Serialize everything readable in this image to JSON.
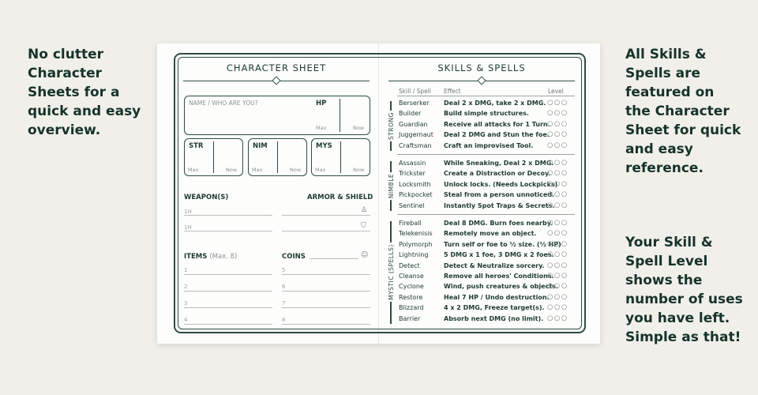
{
  "left_caption": "No clutter Character Sheets for a quick and easy overview.",
  "right_caption_top": "All Skills & Spells are featured on the Character Sheet for quick and easy reference.",
  "right_caption_bottom": "Your Skill & Spell Level shows the number of uses you have left. Simple as that!",
  "character_sheet": {
    "title": "CHARACTER SHEET",
    "name_placeholder": "NAME / WHO ARE YOU?",
    "hp_label": "HP",
    "max": "Max",
    "now": "Now",
    "stats": [
      "STR",
      "NIM",
      "MYS"
    ],
    "weapons_label": "WEAPON(S)",
    "armor_label": "ARMOR & SHIELD",
    "hand": "1H",
    "items_label": "ITEMS",
    "items_note": "(Max. 8)",
    "coins_label": "COINS",
    "item_numbers": [
      "1",
      "2",
      "3",
      "4",
      "5",
      "6",
      "7",
      "8"
    ]
  },
  "skills_spells": {
    "title": "SKILLS & SPELLS",
    "col_skill": "Skill / Spell",
    "col_effect": "Effect",
    "col_level": "Level",
    "groups": [
      {
        "label": "STRONG",
        "rows": [
          {
            "name": "Berserker",
            "effect": "Deal 2 x DMG, take 2 x DMG."
          },
          {
            "name": "Builder",
            "effect": "Build simple structures."
          },
          {
            "name": "Guardian",
            "effect": "Receive all attacks for 1 Turn."
          },
          {
            "name": "Juggernaut",
            "effect": "Deal 2 DMG and Stun the foe."
          },
          {
            "name": "Craftsman",
            "effect": "Craft an improvised Tool."
          }
        ]
      },
      {
        "label": "NIMBLE",
        "rows": [
          {
            "name": "Assassin",
            "effect": "While Sneaking, Deal 2 x DMG."
          },
          {
            "name": "Trickster",
            "effect": "Create a Distraction or Decoy."
          },
          {
            "name": "Locksmith",
            "effect": "Unlock locks. (Needs Lockpicks)"
          },
          {
            "name": "Pickpocket",
            "effect": "Steal from a person unnoticed."
          },
          {
            "name": "Sentinel",
            "effect": "Instantly Spot Traps & Secrets."
          }
        ]
      },
      {
        "label": "MYSTIC (SPELLS)",
        "rows": [
          {
            "name": "Fireball",
            "effect": "Deal 8 DMG. Burn foes nearby."
          },
          {
            "name": "Telekenisis",
            "effect": "Remotely move an object."
          },
          {
            "name": "Polymorph",
            "effect": "Turn self or foe to ½ size. (½ HP)"
          },
          {
            "name": "Lightning",
            "effect": "5 DMG x 1 foe, 3 DMG x 2 foes."
          },
          {
            "name": "Detect",
            "effect": "Detect & Neutralize sorcery."
          },
          {
            "name": "Cleanse",
            "effect": "Remove all heroes' Conditions."
          },
          {
            "name": "Cyclone",
            "effect": "Wind, push creatures & objects."
          },
          {
            "name": "Restore",
            "effect": "Heal 7 HP / Undo destruction."
          },
          {
            "name": "Blizzard",
            "effect": "4 x 2 DMG, Freeze target(s)."
          },
          {
            "name": "Barrier",
            "effect": "Absorb next DMG (no limit)."
          }
        ]
      }
    ],
    "level_marks": "○○○"
  }
}
